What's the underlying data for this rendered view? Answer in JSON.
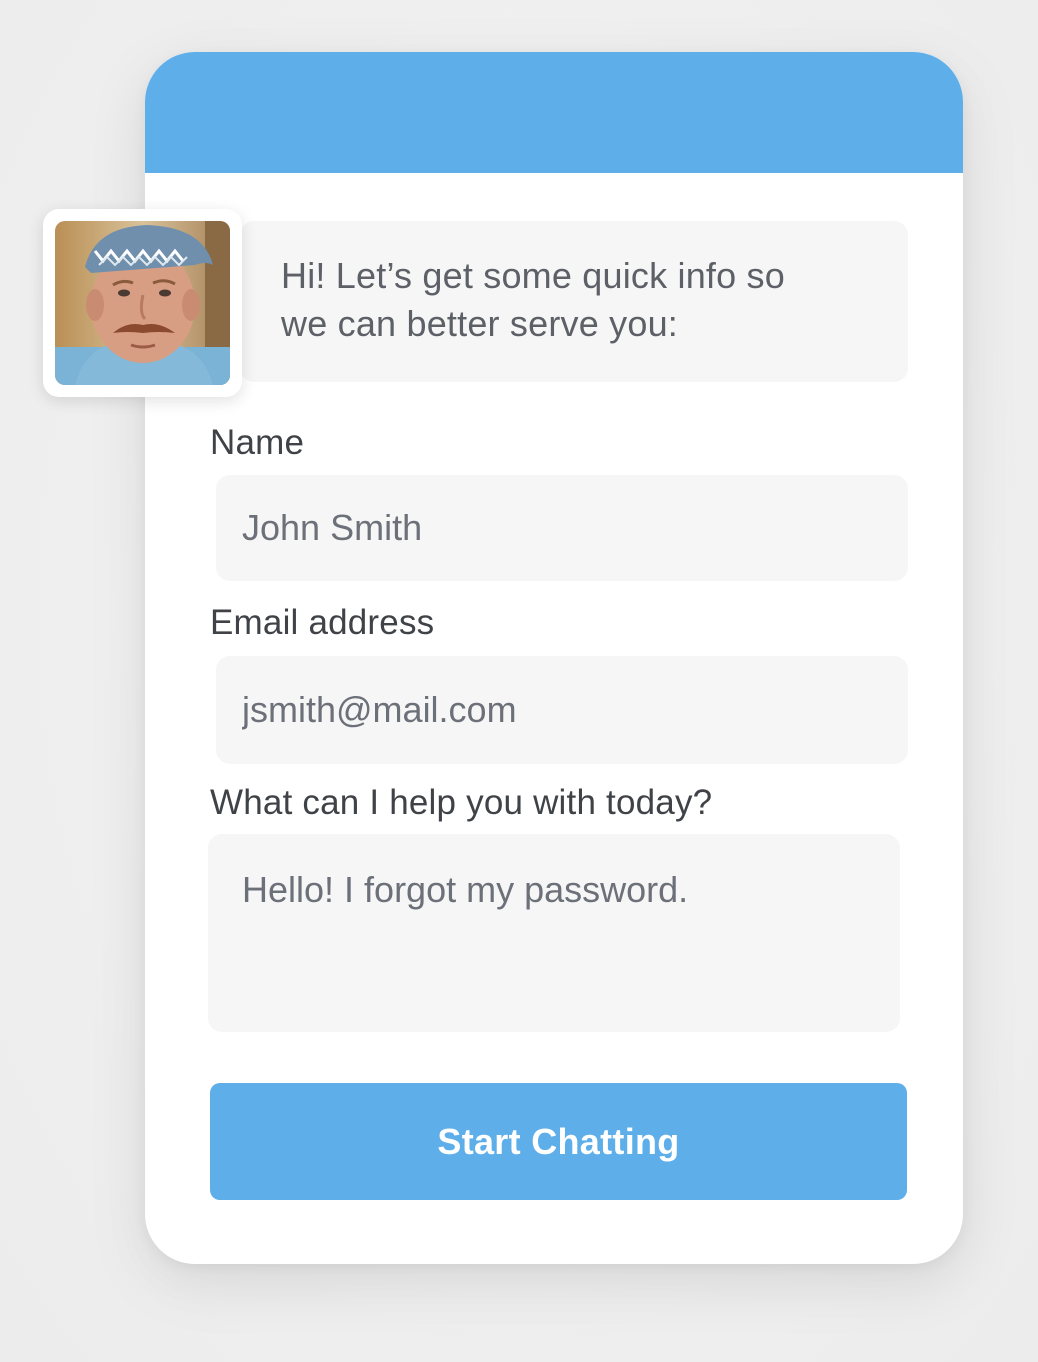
{
  "colors": {
    "accent": "#5eaeea",
    "field_background": "#f6f6f7",
    "card_background": "#ffffff",
    "page_background": "#efefef"
  },
  "agent": {
    "avatar_icon": "agent-photo"
  },
  "greeting": {
    "line1": "Hi! Let’s get some quick info so",
    "line2": "we can better serve you:"
  },
  "form": {
    "name": {
      "label": "Name",
      "value": "John Smith"
    },
    "email": {
      "label": "Email address",
      "value": "jsmith@mail.com"
    },
    "message": {
      "label": "What can I help you with today?",
      "value": "Hello! I forgot my password."
    },
    "submit_label": "Start Chatting"
  }
}
